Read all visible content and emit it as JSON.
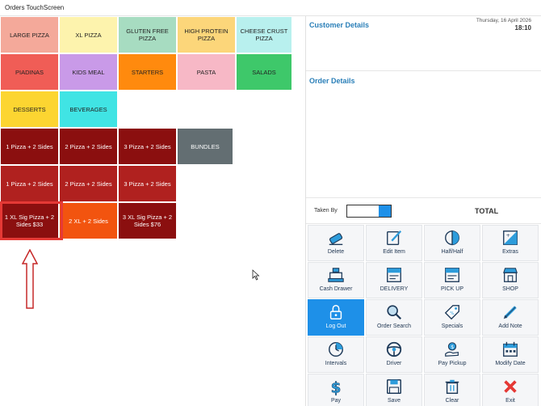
{
  "window": {
    "title": "Orders TouchScreen"
  },
  "categories": [
    {
      "label": "LARGE PIZZA",
      "color": "#f4a99a"
    },
    {
      "label": "XL PIZZA",
      "color": "#fdf3ad"
    },
    {
      "label": "GLUTEN FREE PIZZA",
      "color": "#a7dcc1"
    },
    {
      "label": "HIGH PROTEIN PIZZA",
      "color": "#fcd67a"
    },
    {
      "label": "CHEESE CRUST PIZZA",
      "color": "#b8f0ee"
    },
    {
      "label": "PIADINAS",
      "color": "#f05d56"
    },
    {
      "label": "KIDS MEAL",
      "color": "#c99ae8"
    },
    {
      "label": "STARTERS",
      "color": "#ff8a0e"
    },
    {
      "label": "PASTA",
      "color": "#f7b8c6"
    },
    {
      "label": "SALADS",
      "color": "#3ec86a"
    },
    {
      "label": "DESSERTS",
      "color": "#fcd531"
    },
    {
      "label": "BEVERAGES",
      "color": "#40e4e4"
    }
  ],
  "deals_row1": [
    {
      "label": "1 Pizza + 2 Sides",
      "color": "#8b0f0f"
    },
    {
      "label": "2 Pizza + 2 Sides",
      "color": "#8b0f0f"
    },
    {
      "label": "3 Pizza + 2 Sides",
      "color": "#8b0f0f"
    },
    {
      "label": "BUNDLES",
      "color": "#636e72"
    }
  ],
  "deals_row2": [
    {
      "label": "1 Pizza + 2 Sides",
      "color": "#b0211f"
    },
    {
      "label": "2 Pizza + 2 Sides",
      "color": "#b0211f"
    },
    {
      "label": "3 Pizza + 2 Sides",
      "color": "#b0211f"
    }
  ],
  "deals_row3": [
    {
      "label": "1 XL Sig Pizza + 2 Sides $33",
      "color": "#8b0f0f"
    },
    {
      "label": "2 XL + 2 Sides",
      "color": "#f2540f"
    },
    {
      "label": "3 XL Sig Pizza + 2 Sides $76",
      "color": "#8b0f0f"
    }
  ],
  "panel": {
    "customer_details": "Customer Details",
    "order_details": "Order Details",
    "date": "Thursday, 16 April 2026",
    "time": "18:10",
    "taken_by_label": "Taken By",
    "total_label": "TOTAL"
  },
  "actions": [
    {
      "label": "Delete",
      "icon": "eraser-icon"
    },
    {
      "label": "Edit Item",
      "icon": "edit-icon"
    },
    {
      "label": "Half/Half",
      "icon": "half-circle-icon"
    },
    {
      "label": "Extras",
      "icon": "extras-icon"
    },
    {
      "label": "Cash Drawer",
      "icon": "cash-register-icon"
    },
    {
      "label": "DELIVERY",
      "icon": "delivery-icon"
    },
    {
      "label": "PICK UP",
      "icon": "pickup-icon"
    },
    {
      "label": "SHOP",
      "icon": "shop-icon"
    },
    {
      "label": "Log Out",
      "icon": "lock-icon"
    },
    {
      "label": "Order Search",
      "icon": "search-icon"
    },
    {
      "label": "Specials",
      "icon": "tag-icon"
    },
    {
      "label": "Add Note",
      "icon": "pencil-icon"
    },
    {
      "label": "Intervals",
      "icon": "clock-icon"
    },
    {
      "label": "Driver",
      "icon": "steering-wheel-icon"
    },
    {
      "label": "Pay Pickup",
      "icon": "money-hand-icon"
    },
    {
      "label": "Modify Date",
      "icon": "calendar-icon"
    },
    {
      "label": "Pay",
      "icon": "dollar-icon"
    },
    {
      "label": "Save",
      "icon": "save-icon"
    },
    {
      "label": "Clear",
      "icon": "trash-icon"
    },
    {
      "label": "Exit",
      "icon": "close-icon"
    }
  ],
  "colors": {
    "accent": "#1e90e8",
    "heading": "#2a7fb8",
    "highlight": "#e53935"
  }
}
